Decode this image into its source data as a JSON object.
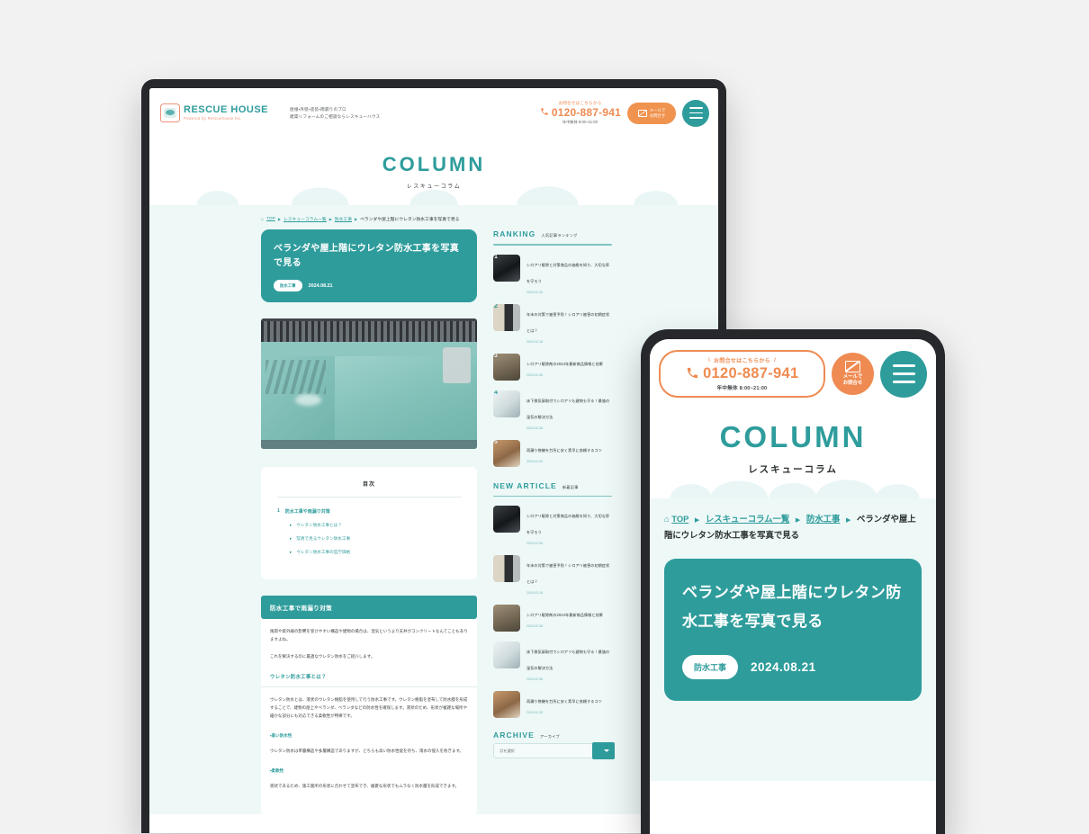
{
  "brand": {
    "logo_name": "RESCUE HOUSE",
    "logo_sub": "Powered by  Rescuehouse Inc.",
    "tagline_line1": "屋根・外壁・塗装・雨漏りのプロ",
    "tagline_line2": "建築リフォームのご相談ならレスキューハウス",
    "accent_teal": "#2f9c9c",
    "accent_orange": "#ef8b52"
  },
  "contact": {
    "lead": "お問合せはこちらから",
    "phone": "0120-887-941",
    "hours": "年中無休 8:00~21:00",
    "mail_line1": "メールで",
    "mail_line2": "お問合せ",
    "phone_icon": "phone-icon",
    "mail_icon": "envelope-icon",
    "menu_icon": "hamburger-menu-icon"
  },
  "hero": {
    "title": "COLUMN",
    "subtitle": "レスキューコラム"
  },
  "breadcrumb": {
    "home_icon": "home-icon",
    "items": [
      "TOP",
      "レスキューコラム一覧",
      "防水工事"
    ],
    "current": "ベランダや屋上階にウレタン防水工事を写真で見る",
    "separator": "▶"
  },
  "article": {
    "title": "ベランダや屋上階にウレタン防水工事を写真で見る",
    "tag": "防水工事",
    "date": "2024.08.21",
    "photo_alt": "ウレタン防水を施工したベランダの写真",
    "toc_heading": "目次",
    "toc": [
      {
        "level": 1,
        "marker": "1",
        "label": "防水工事や雨漏り対策"
      },
      {
        "level": 2,
        "marker": "▸",
        "label": "ウレタン防水工事とは？"
      },
      {
        "level": 2,
        "marker": "▸",
        "label": "写真で見るウレタン防水工事"
      },
      {
        "level": 2,
        "marker": "▸",
        "label": "ウレタン防水工事の官庁価格"
      }
    ],
    "h2": "防水工事で雨漏り対策",
    "p1": "風雨や紫外線の影響を受けやすい構造や建物の場合は、湿気というより天井がコンクリートなんてこともありますよね。",
    "p2": "これを解決するのに最適なウレタン防水をご紹介します。",
    "h3": "ウレタン防水工事とは？",
    "p3": "ウレタン防水とは、液状のウレタン樹脂を使用して行う防水工事です。ウレタン樹脂を塗布して防水膜を形成することで、建物の屋上やベランダ、ベランダなどの防水性を確保します。液状のため、形状が複雑な場所や細かな部分にも対応できる柔軟性が特徴です。",
    "h4a": "・高い防水性",
    "p4": "ウレタン防水は単層構造や多層構造でありますが、どちらも高い防水性能を持ち、雨水の侵入を防ぎます。",
    "h4b": "・柔軟性",
    "p5": "液状であるため、施工箇所の形状に合わせて塗布でき、複雑な形状でもムラなく防水層を形成できます。"
  },
  "sidebar": {
    "ranking": {
      "title_en": "RANKING",
      "title_jp": "人気記事ランキング",
      "items": [
        {
          "rank": "1",
          "title": "シロアリ駆除と対策商品の価格を知り、大切な家を守ろう",
          "date": "2024.02.08"
        },
        {
          "rank": "2",
          "title": "年末の対策で被害予防！シロアリ被害の初期症状とは？",
          "date": "2024.02.18"
        },
        {
          "rank": "3",
          "title": "シロアリ駆除剤の2024年最新商品情報と効果",
          "date": "2024.02.08"
        },
        {
          "rank": "4",
          "title": "床下換気扇取付でシロアリも建物も守る！最強の湿気の解決方法",
          "date": "2024.02.08"
        },
        {
          "rank": "5",
          "title": "雨漏り修繕を台所に安く素早に依頼するコツ",
          "date": "2024.02.05"
        }
      ]
    },
    "new_article": {
      "title_en": "NEW ARTICLE",
      "title_jp": "新着記事",
      "items": [
        {
          "title": "シロアリ駆除と対策商品の価格を知り、大切な家を守ろう",
          "date": "2024.02.08"
        },
        {
          "title": "年末の対策で被害予防！シロアリ被害の初期症状とは？",
          "date": "2024.02.18"
        },
        {
          "title": "シロアリ駆除剤の2024年最新商品情報と効果",
          "date": "2024.02.08"
        },
        {
          "title": "床下換気扇取付でシロアリも建物も守る！最強の湿気の解決方法",
          "date": "2024.02.08"
        },
        {
          "title": "雨漏り修繕を台所に安く素早に依頼するコツ",
          "date": "2024.02.05"
        }
      ]
    },
    "archive": {
      "title_en": "ARCHIVE",
      "title_jp": "アーカイブ",
      "select_placeholder": "月を選択",
      "chevron_icon": "chevron-down-icon"
    }
  }
}
